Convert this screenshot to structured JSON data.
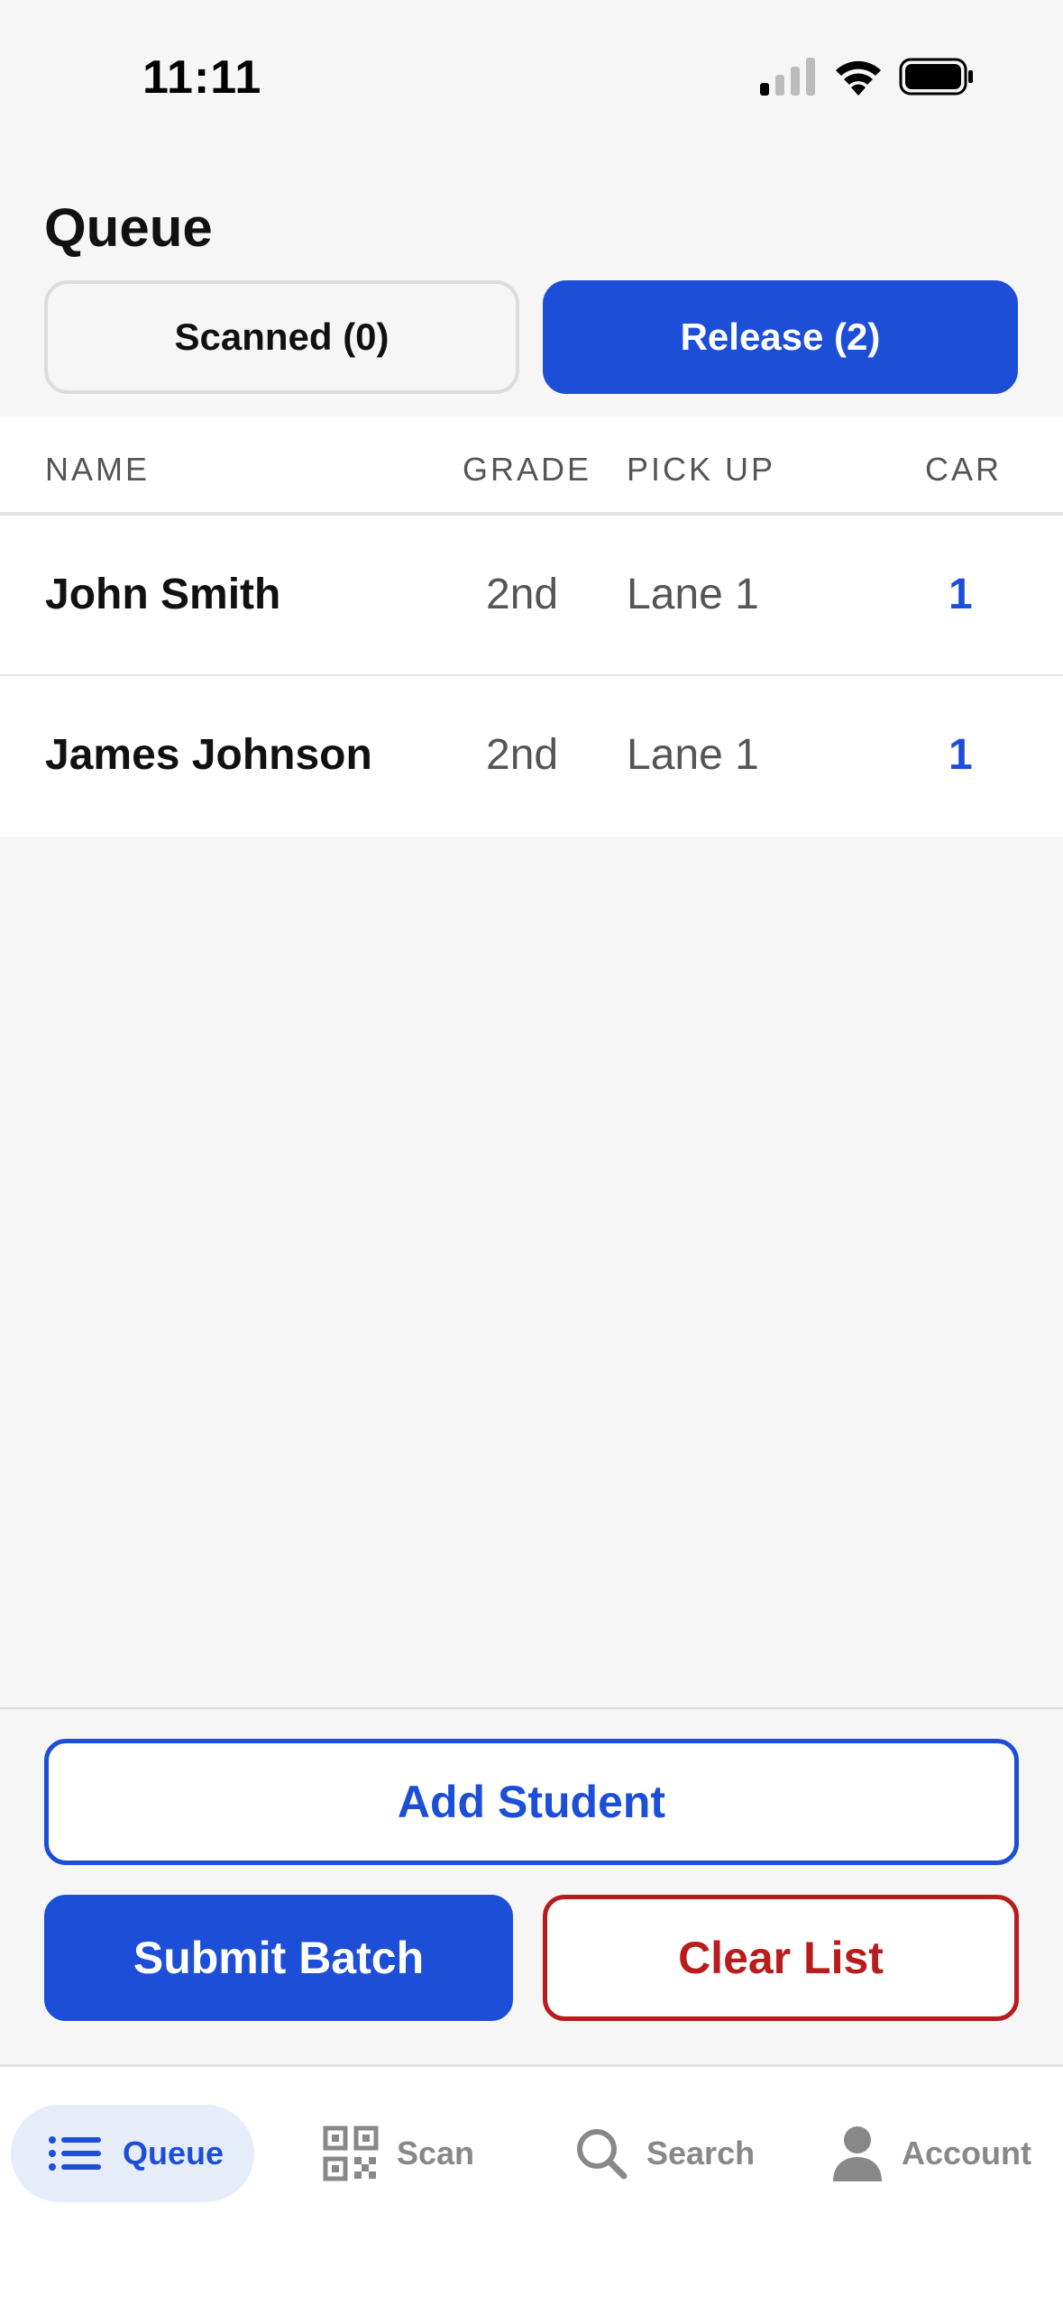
{
  "status_bar": {
    "time": "11:11"
  },
  "page": {
    "title": "Queue"
  },
  "segments": {
    "scanned_label": "Scanned (0)",
    "release_label": "Release (2)"
  },
  "table": {
    "headers": {
      "name": "NAME",
      "grade": "GRADE",
      "pickup": "PICK UP",
      "car": "CAR"
    },
    "rows": [
      {
        "name": "John Smith",
        "grade": "2nd",
        "pickup": "Lane 1",
        "car": "1"
      },
      {
        "name": "James Johnson",
        "grade": "2nd",
        "pickup": "Lane 1",
        "car": "1"
      }
    ]
  },
  "actions": {
    "add_student_label": "Add Student",
    "submit_batch_label": "Submit Batch",
    "clear_list_label": "Clear List"
  },
  "tabs": {
    "queue": {
      "label": "Queue",
      "icon": "list-icon"
    },
    "scan": {
      "label": "Scan",
      "icon": "qr-code-icon"
    },
    "search": {
      "label": "Search",
      "icon": "search-icon"
    },
    "account": {
      "label": "Account",
      "icon": "person-icon"
    }
  },
  "colors": {
    "accent": "#1d4ed8",
    "danger": "#b91c1c",
    "background": "#f6f6f6"
  }
}
